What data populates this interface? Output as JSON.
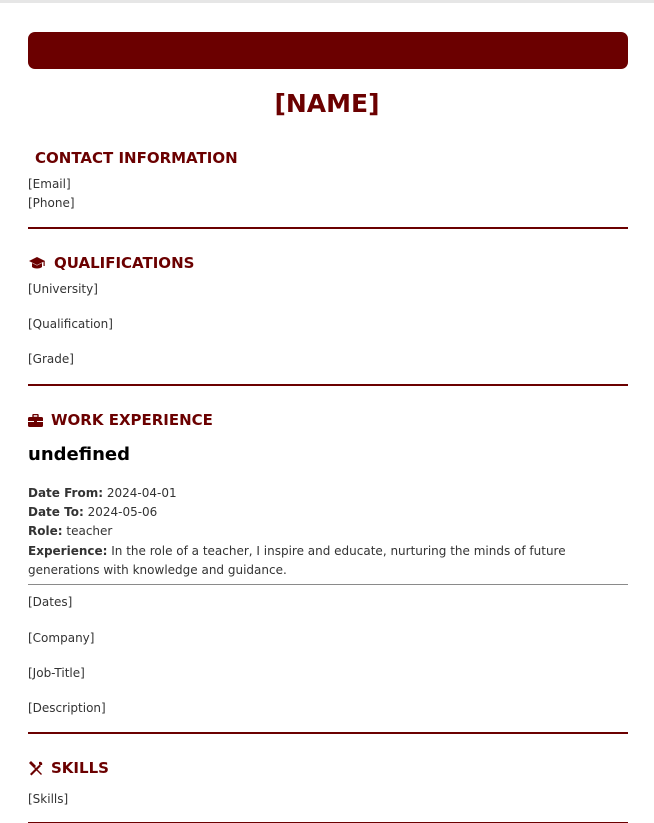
{
  "name": "[NAME]",
  "contact": {
    "heading": "CONTACT INFORMATION",
    "email": "[Email]",
    "phone": "[Phone]"
  },
  "qualifications": {
    "heading": "QUALIFICATIONS",
    "icon": "graduation-cap-icon",
    "university": "[University]",
    "qualification": "[Qualification]",
    "grade": "[Grade]"
  },
  "work": {
    "heading": "WORK EXPERIENCE",
    "icon": "briefcase-icon",
    "entry_title": "undefined",
    "date_from_label": "Date From:",
    "date_from": "2024-04-01",
    "date_to_label": "Date To:",
    "date_to": "2024-05-06",
    "role_label": "Role:",
    "role": "teacher",
    "experience_label": "Experience:",
    "experience": "In the role of a teacher, I inspire and educate, nurturing the minds of future generations with knowledge and guidance.",
    "dates": "[Dates]",
    "company": "[Company]",
    "job_title": "[Job-Title]",
    "description": "[Description]"
  },
  "skills": {
    "heading": "SKILLS",
    "icon": "tools-icon",
    "value": "[Skills]"
  },
  "colors": {
    "accent": "#6b0000",
    "text": "#333333"
  }
}
